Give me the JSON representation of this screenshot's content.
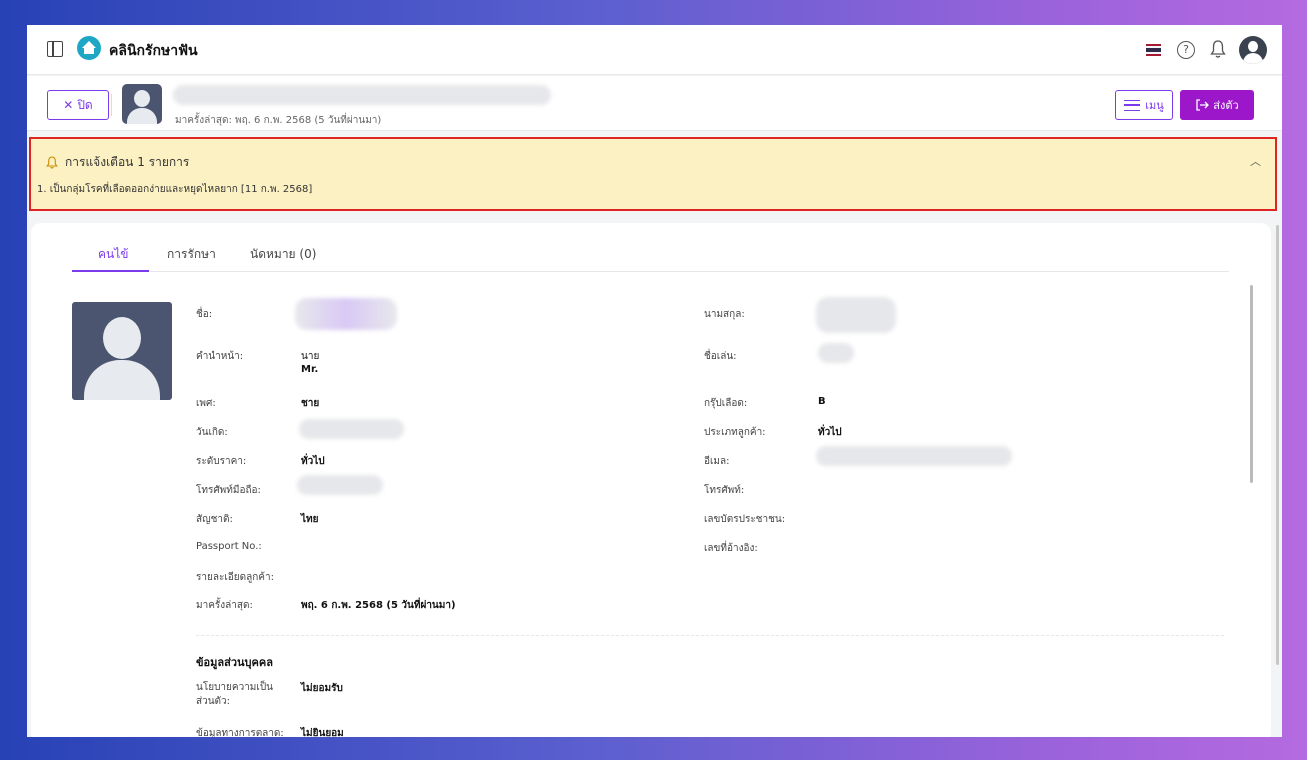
{
  "app": {
    "title": "คลินิกรักษาฟัน",
    "language_flag": "flag-icon-th",
    "colors": {
      "accent": "#7c3aed",
      "primary_button": "#9b17c9",
      "alert_bg": "#fcf1c2",
      "alert_border": "#e02424"
    }
  },
  "header": {
    "close_label": "ปิด",
    "last_visit": "มาครั้งล่าสุด: พฤ. 6 ก.พ. 2568 (5 วันที่ผ่านมา)",
    "menu_label": "เมนู",
    "send_label": "ส่งตัว"
  },
  "alert": {
    "title": "การแจ้งเตือน 1 รายการ",
    "items": [
      "1. เป็นกลุ่มโรคที่เลือดออกง่ายและหยุดไหลยาก [11 ก.พ. 2568]"
    ]
  },
  "tabs": [
    {
      "label": "คนไข้"
    },
    {
      "label": "การรักษา"
    },
    {
      "label": "นัดหมาย (0)"
    }
  ],
  "profile": {
    "left": [
      {
        "label": "ชื่อ:",
        "value": ""
      },
      {
        "label": "คำนำหน้า:",
        "value": "นาย",
        "value2": "Mr."
      },
      {
        "label": "เพศ:",
        "value": "ชาย"
      },
      {
        "label": "วันเกิด:",
        "value": ""
      },
      {
        "label": "ระดับราคา:",
        "value": "ทั่วไป"
      },
      {
        "label": "โทรศัพท์มือถือ:",
        "value": ""
      },
      {
        "label": "สัญชาติ:",
        "value": "ไทย"
      },
      {
        "label": "Passport No.:",
        "value": ""
      },
      {
        "label": "รายละเอียดลูกค้า:",
        "value": ""
      },
      {
        "label": "มาครั้งล่าสุด:",
        "value": "พฤ. 6 ก.พ. 2568 (5 วันที่ผ่านมา)"
      }
    ],
    "right": [
      {
        "label": "นามสกุล:",
        "value": ""
      },
      {
        "label": "ชื่อเล่น:",
        "value": ""
      },
      {
        "label": "กรุ๊ปเลือด:",
        "value": "B"
      },
      {
        "label": "ประเภทลูกค้า:",
        "value": "ทั่วไป"
      },
      {
        "label": "อีเมล:",
        "value": ""
      },
      {
        "label": "โทรศัพท์:",
        "value": ""
      },
      {
        "label": "เลขบัตรประชาชน:",
        "value": ""
      },
      {
        "label": "เลขที่อ้างอิง:",
        "value": ""
      }
    ]
  },
  "personal": {
    "title": "ข้อมูลส่วนบุคคล",
    "privacy_label": "นโยบายความเป็น ส่วนตัว:",
    "privacy_value": "ไม่ยอมรับ",
    "marketing_label": "ข้อมูลทางการตลาด:",
    "marketing_value": "ไม่ยินยอม"
  }
}
